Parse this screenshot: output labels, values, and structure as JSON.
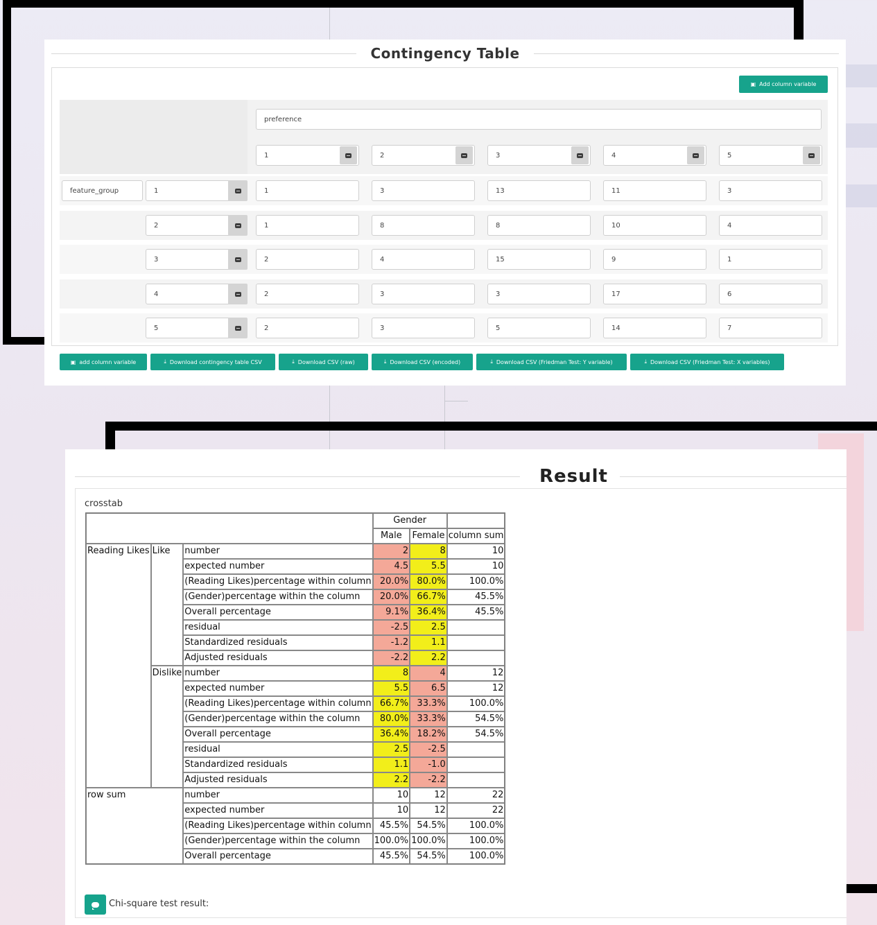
{
  "contingency": {
    "title": "Contingency Table",
    "add_column_top_label": "Add column variable",
    "column_variable": "preference",
    "column_levels": [
      "1",
      "2",
      "3",
      "4",
      "5"
    ],
    "row_variable": "feature_group",
    "row_levels": [
      "1",
      "2",
      "3",
      "4",
      "5"
    ],
    "counts": [
      [
        "1",
        "3",
        "13",
        "11",
        "3"
      ],
      [
        "1",
        "8",
        "8",
        "10",
        "4"
      ],
      [
        "2",
        "4",
        "15",
        "9",
        "1"
      ],
      [
        "2",
        "3",
        "3",
        "17",
        "6"
      ],
      [
        "2",
        "3",
        "5",
        "14",
        "7"
      ]
    ],
    "bottom_buttons": [
      "add column variable",
      "Download contingency table CSV",
      "Download CSV (raw)",
      "Download CSV (encoded)",
      "Download CSV (Friedman Test: Y variable)",
      "Download CSV (Friedman Test: X variables)"
    ],
    "accent_color": "#17a38c"
  },
  "result": {
    "title": "Result",
    "crosstab_label": "crosstab",
    "header": {
      "group": "Gender",
      "male": "Male",
      "female": "Female",
      "column_sum": "column sum"
    },
    "row_var": "Reading Likes",
    "like": "Like",
    "dislike": "Dislike",
    "row_sum": "row sum",
    "stats": {
      "number": "number",
      "expected": "expected number",
      "pct_row": "(Reading Likes)percentage within column",
      "pct_col": "(Gender)percentage within the column",
      "overall": "Overall percentage",
      "residual": "residual",
      "std_resid": "Standardized residuals",
      "adj_resid": "Adjusted residuals"
    },
    "like_rows": [
      [
        "2",
        "8",
        "10"
      ],
      [
        "4.5",
        "5.5",
        "10"
      ],
      [
        "20.0%",
        "80.0%",
        "100.0%"
      ],
      [
        "20.0%",
        "66.7%",
        "45.5%"
      ],
      [
        "9.1%",
        "36.4%",
        "45.5%"
      ],
      [
        "-2.5",
        "2.5",
        ""
      ],
      [
        "-1.2",
        "1.1",
        ""
      ],
      [
        "-2.2",
        "2.2",
        ""
      ]
    ],
    "dislike_rows": [
      [
        "8",
        "4",
        "12"
      ],
      [
        "5.5",
        "6.5",
        "12"
      ],
      [
        "66.7%",
        "33.3%",
        "100.0%"
      ],
      [
        "80.0%",
        "33.3%",
        "54.5%"
      ],
      [
        "36.4%",
        "18.2%",
        "54.5%"
      ],
      [
        "2.5",
        "-2.5",
        ""
      ],
      [
        "1.1",
        "-1.0",
        ""
      ],
      [
        "2.2",
        "-2.2",
        ""
      ]
    ],
    "sum_rows": [
      [
        "10",
        "12",
        "22"
      ],
      [
        "10",
        "12",
        "22"
      ],
      [
        "45.5%",
        "54.5%",
        "100.0%"
      ],
      [
        "100.0%",
        "100.0%",
        "100.0%"
      ],
      [
        "45.5%",
        "54.5%",
        "100.0%"
      ]
    ],
    "chi_label": "Chi-square test result:",
    "highlight_colors": {
      "low": "#f4a898",
      "high": "#f2ee1a"
    }
  }
}
